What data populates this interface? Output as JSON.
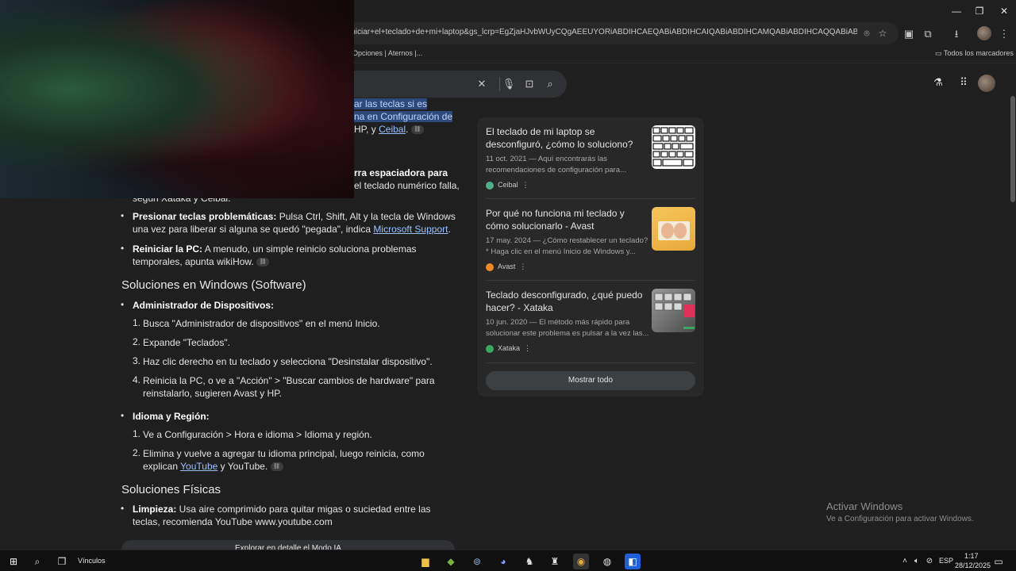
{
  "window": {
    "minimize": "—",
    "restore": "❐",
    "close": "✕"
  },
  "omnibox": {
    "url": "iniciar+el+teclado+de+mi+laptop&gs_lcrp=EgZjaHJvbWUyCQgAEEUYORiABDIHCAEQABiABDIHCAIQABiABDIHCAMQABiABDIHCAQQABiABDIICAUQAB..."
  },
  "bookmarks": {
    "left_item": "Opciones | Aternos |...",
    "all_bookmarks": "Todos los marcadores"
  },
  "answer": {
    "frag1": "ar las teclas si es",
    "frag2": "na en Configuración de",
    "frag3a": "HP, y ",
    "frag3_link": "Ceibal",
    "frag3b": ".",
    "frag4": "rra espaciadora para",
    "frag5": "el teclado numérico falla,",
    "frag6": "según Xataka y Ceibal.",
    "b1_bold": "Presionar teclas problemáticas:",
    "b1_text": " Pulsa Ctrl, Shift, Alt y la tecla de Windows una vez para liberar si alguna se quedó \"pegada\", indica ",
    "b1_link": "Microsoft Support",
    "b1_end": ".",
    "b2_bold": "Reiniciar la PC:",
    "b2_text": " A menudo, un simple reinicio soluciona problemas temporales, apunta wikiHow.",
    "h_software": "Soluciones en Windows (Software)",
    "dev_title": "Administrador de Dispositivos:",
    "dev_steps": [
      "Busca \"Administrador de dispositivos\" en el menú Inicio.",
      "Expande \"Teclados\".",
      "Haz clic derecho en tu teclado y selecciona \"Desinstalar dispositivo\".",
      "Reinicia la PC, o ve a \"Acción\" > \"Buscar cambios de hardware\" para reinstalarlo, sugieren Avast y HP."
    ],
    "lang_title": "Idioma y Región:",
    "lang_step1": "Ve a Configuración > Hora e idioma > Idioma y región.",
    "lang_step2_text": "Elimina y vuelve a agregar tu idioma principal, luego reinicia, como explican ",
    "lang_step2_link": "YouTube",
    "lang_step2_end": " y YouTube.",
    "h_physical": "Soluciones Físicas",
    "clean_bold": "Limpieza:",
    "clean_text": " Usa aire comprimido para quitar migas o suciedad entre las teclas, recomienda YouTube www.youtube.com",
    "explore_btn": "Explorar en detalle el Modo IA"
  },
  "sources": [
    {
      "title": "El teclado de mi laptop se desconfiguró, ¿cómo lo soluciono?",
      "snippet": "11 oct. 2021 — Aquí encontrarás las recomendaciones de configuración para...",
      "source": "Ceibal",
      "color": "#4fb08a"
    },
    {
      "title": "Por qué no funciona mi teclado y cómo solucionarlo - Avast",
      "snippet": "17 may. 2024 — ¿Cómo restablecer un teclado? * Haga clic en el menú Inicio de Windows y...",
      "source": "Avast",
      "color": "#f08a24"
    },
    {
      "title": "Teclado desconfigurado, ¿qué puedo hacer? - Xataka",
      "snippet": "10 jun. 2020 — El método más rápido para solucionar este problema es pulsar a la vez las...",
      "source": "Xataka",
      "color": "#3aa860"
    }
  ],
  "show_all": "Mostrar todo",
  "activate": {
    "title": "Activar Windows",
    "subtitle": "Ve a Configuración para activar Windows."
  },
  "taskbar": {
    "links": "Vínculos",
    "lang": "ESP",
    "time": "1:17",
    "date": "28/12/2025"
  }
}
